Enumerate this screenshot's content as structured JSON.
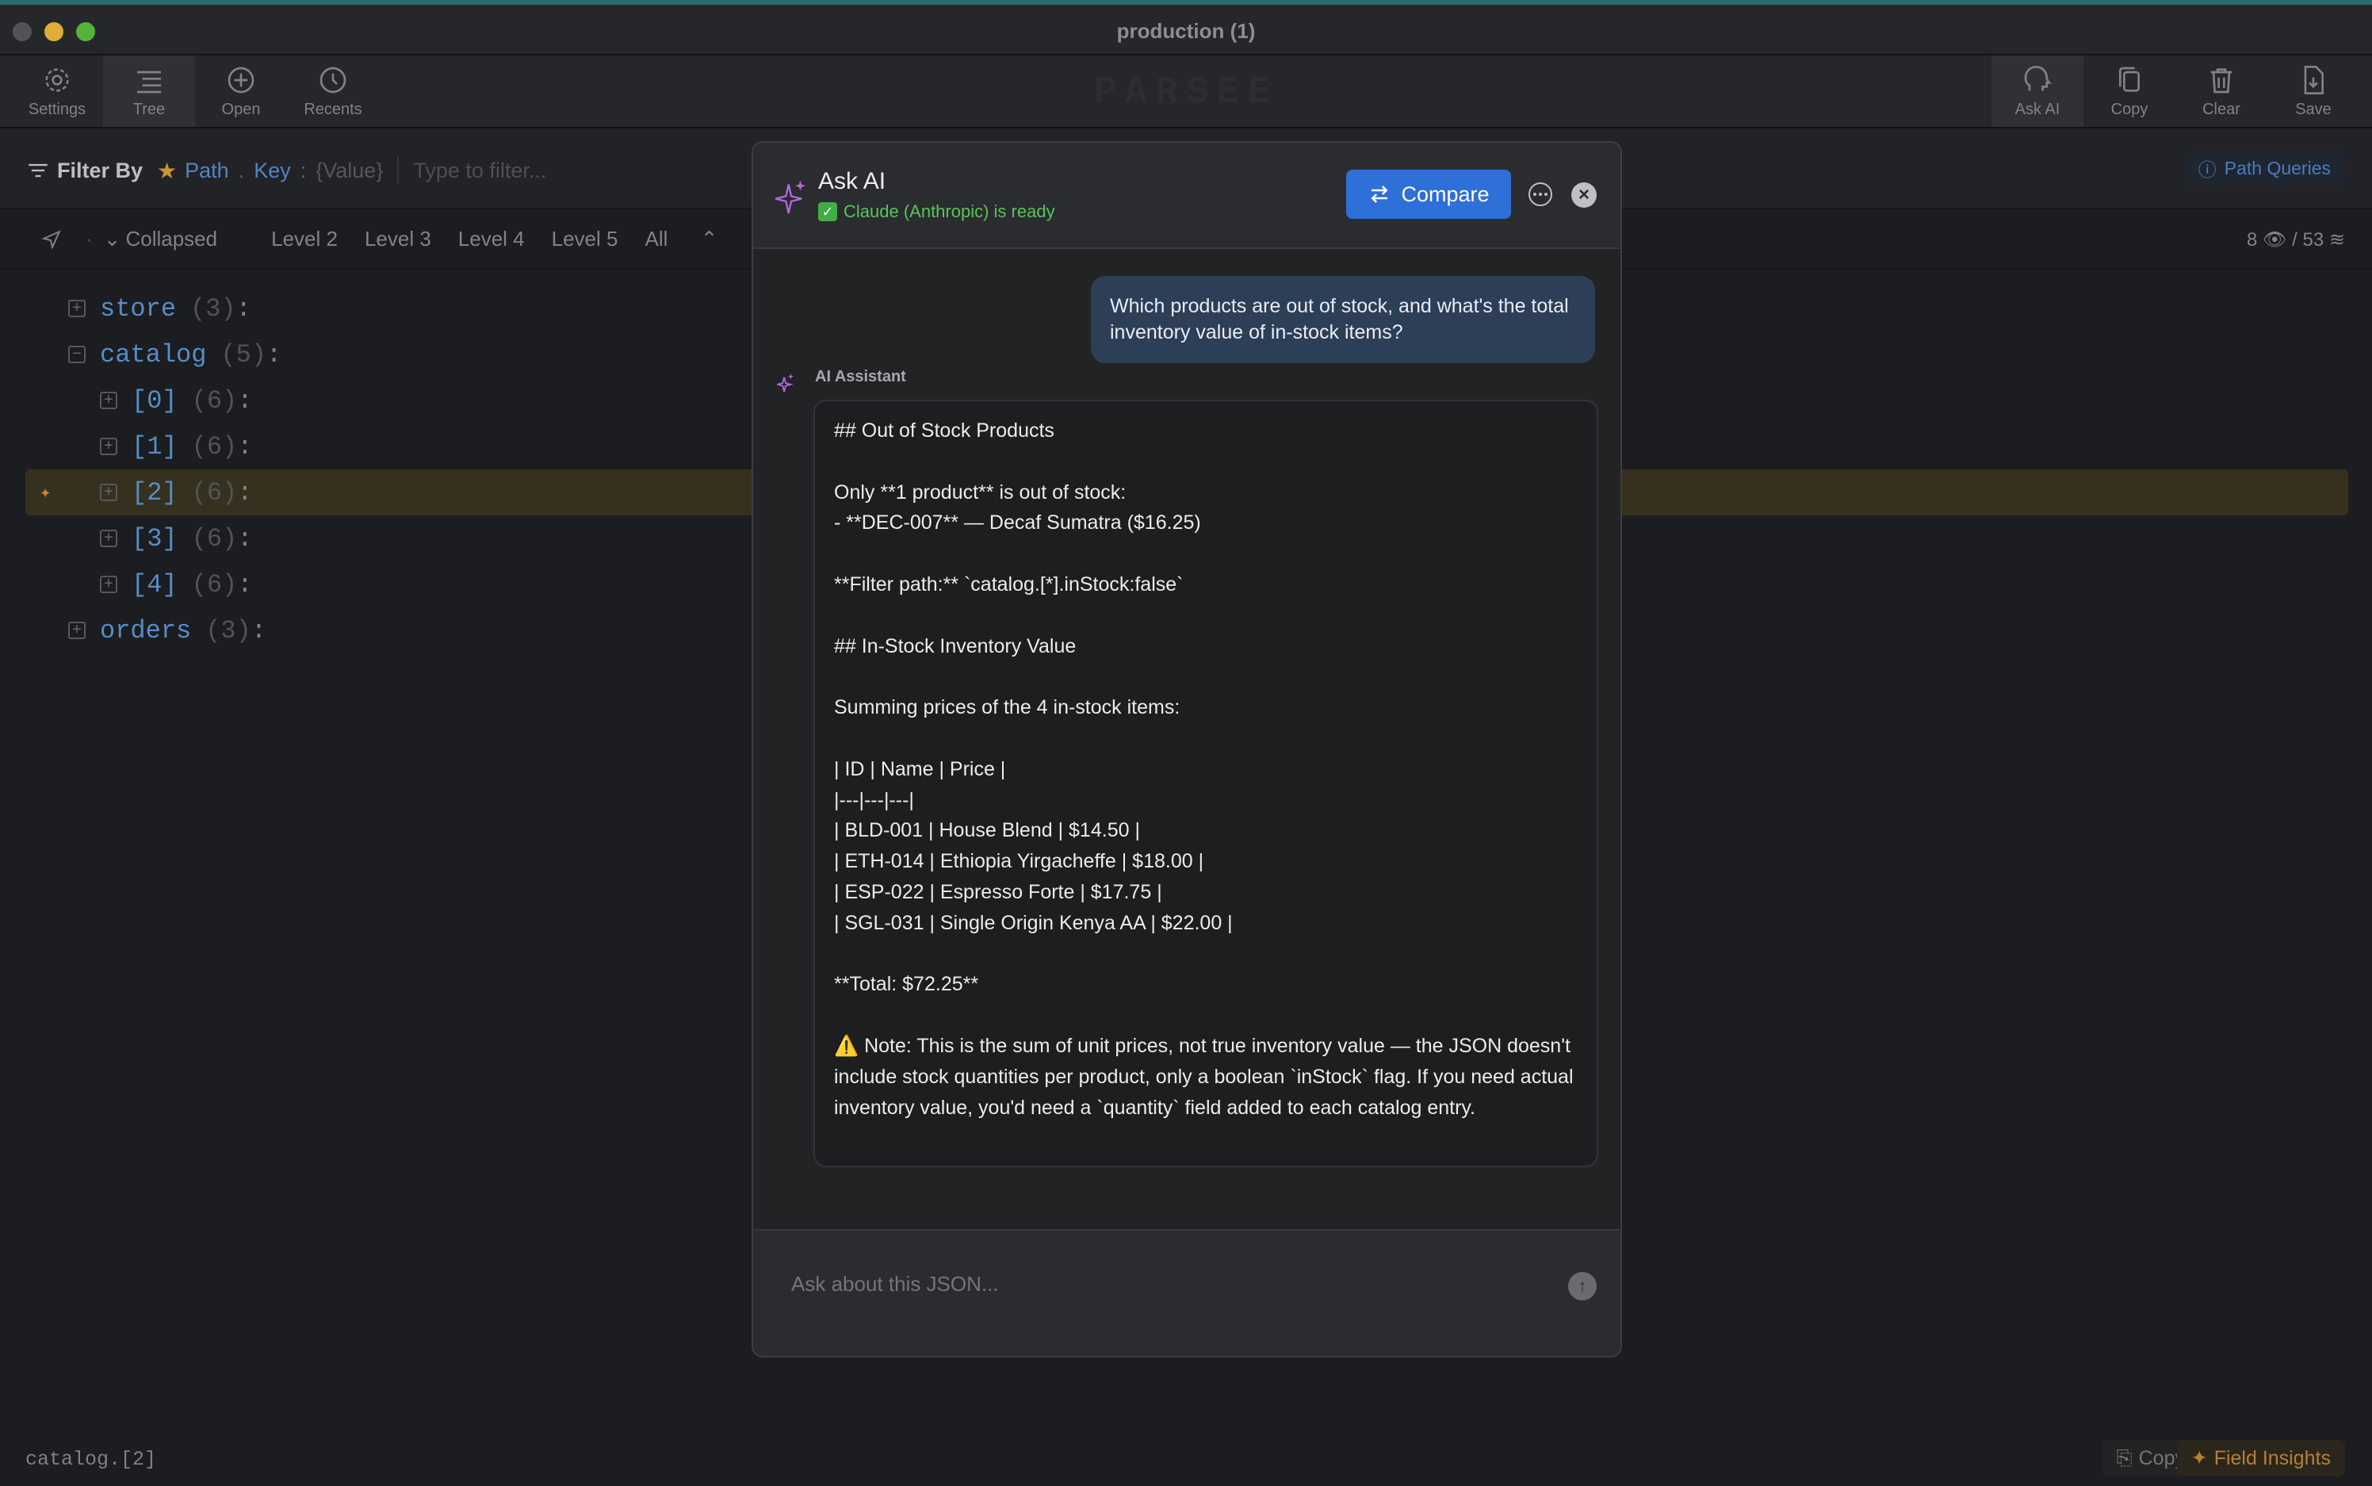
{
  "window": {
    "title": "production (1)",
    "brand": "PARSEE"
  },
  "toolbar": {
    "settings": "Settings",
    "tree": "Tree",
    "open": "Open",
    "recents": "Recents",
    "ask_ai": "Ask AI",
    "copy": "Copy",
    "clear": "Clear",
    "save": "Save"
  },
  "filter": {
    "label": "Filter By",
    "path": "Path",
    "sep": ".",
    "key": "Key",
    "colon": ":",
    "value": "{Value}",
    "placeholder": "Type to filter...",
    "path_queries": "Path Queries"
  },
  "levels": {
    "collapsed": "Collapsed",
    "items": [
      "Level 2",
      "Level 3",
      "Level 4",
      "Level 5",
      "All"
    ],
    "visible_count": "8",
    "total_count": "53",
    "sep": "/"
  },
  "tree": {
    "rows": [
      {
        "key": "store",
        "count": "(3)",
        "colon": ":",
        "toggle": "+"
      },
      {
        "key": "catalog",
        "count": "(5)",
        "colon": ":",
        "toggle": "−"
      },
      {
        "key": "[0]",
        "count": "(6)",
        "colon": ":",
        "toggle": "+"
      },
      {
        "key": "[1]",
        "count": "(6)",
        "colon": ":",
        "toggle": "+"
      },
      {
        "key": "[2]",
        "count": "(6)",
        "colon": ":",
        "toggle": "+"
      },
      {
        "key": "[3]",
        "count": "(6)",
        "colon": ":",
        "toggle": "+"
      },
      {
        "key": "[4]",
        "count": "(6)",
        "colon": ":",
        "toggle": "+"
      },
      {
        "key": "orders",
        "count": "(3)",
        "colon": ":",
        "toggle": "+"
      }
    ]
  },
  "status": {
    "path": "catalog.[2]",
    "copy": "Copy",
    "insights": "Field Insights"
  },
  "modal": {
    "title": "Ask AI",
    "status": "Claude (Anthropic) is ready",
    "compare": "Compare",
    "user_message": "Which products are out of stock, and what's the total inventory value of in-stock items?",
    "assistant_label": "AI Assistant",
    "response_lines": [
      "## Out of Stock Products",
      "",
      "Only **1 product** is out of stock:",
      "- **DEC-007** — Decaf Sumatra ($16.25)",
      "",
      "**Filter path:** `catalog.[*].inStock:false`",
      "",
      "## In-Stock Inventory Value",
      "",
      "Summing prices of the 4 in-stock items:",
      "",
      "| ID | Name | Price |",
      "|---|---|---|",
      "| BLD-001 | House Blend | $14.50 |",
      "| ETH-014 | Ethiopia Yirgacheffe | $18.00 |",
      "| ESP-022 | Espresso Forte | $17.75 |",
      "| SGL-031 | Single Origin Kenya AA | $22.00 |",
      "",
      "**Total: $72.25**",
      ""
    ],
    "note": "⚠️ Note: This is the sum of unit prices, not true inventory value — the JSON doesn't include stock quantities per product, only a boolean `inStock` flag. If you need actual inventory value, you'd need a `quantity` field added to each catalog entry.",
    "input_placeholder": "Ask about this JSON..."
  }
}
